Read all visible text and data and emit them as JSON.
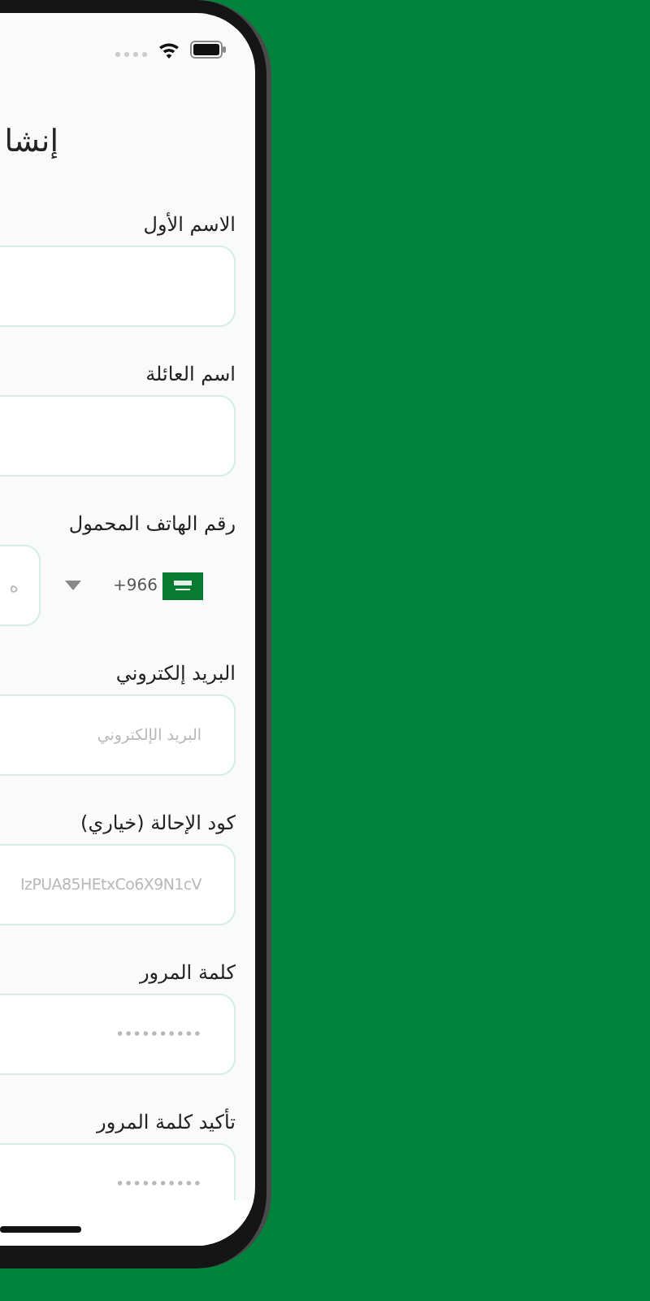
{
  "title": "إنشا",
  "fields": [
    {
      "kind": "text",
      "label": "الاسم الأول"
    },
    {
      "kind": "text",
      "label": "اسم العائلة"
    },
    {
      "kind": "phone",
      "label": "رقم الهاتف المحمول",
      "country_code": "+966",
      "placeholder": "ه"
    },
    {
      "kind": "text",
      "label": "البريد إلكتروني",
      "placeholder": "البريد الإلكتروني"
    },
    {
      "kind": "text",
      "label": "كود الإحالة (خياري)",
      "placeholder": "IzPUA85HEtxCo6X9N1cV"
    },
    {
      "kind": "password",
      "label": "كلمة المرور",
      "placeholder": "••••••••••"
    },
    {
      "kind": "password",
      "label": "تأكيد كلمة المرور",
      "placeholder": "••••••••••"
    }
  ]
}
